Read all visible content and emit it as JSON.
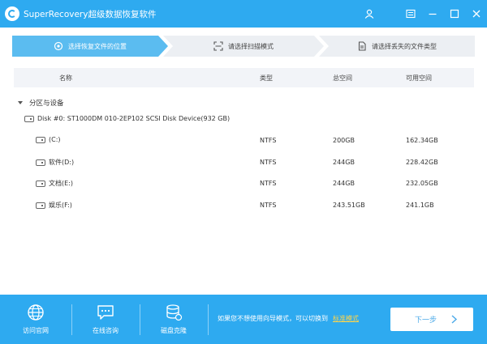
{
  "app": {
    "title": "SuperRecovery超级数据恢复软件"
  },
  "colors": {
    "brand": "#2eaaf0",
    "step_active": "#5bbcf0",
    "step_inactive": "#eceff3",
    "link": "#ffd54a"
  },
  "steps": [
    {
      "label": "选择恢复文件的位置",
      "icon": "location-target-icon",
      "active": true
    },
    {
      "label": "请选择扫描模式",
      "icon": "scan-frame-icon",
      "active": false
    },
    {
      "label": "请选择丢失的文件类型",
      "icon": "document-icon",
      "active": false
    }
  ],
  "table": {
    "headers": {
      "name": "名称",
      "type": "类型",
      "total": "总空间",
      "free": "可用空间"
    },
    "group": {
      "label": "分区与设备"
    },
    "disk": {
      "label": "Disk #0: ST1000DM 010-2EP102 SCSI Disk Device(932 GB)"
    },
    "partitions": [
      {
        "name": "(C:)",
        "type": "NTFS",
        "total": "200GB",
        "free": "162.34GB"
      },
      {
        "name": "软件(D:)",
        "type": "NTFS",
        "total": "244GB",
        "free": "228.42GB"
      },
      {
        "name": "文档(E:)",
        "type": "NTFS",
        "total": "244GB",
        "free": "232.05GB"
      },
      {
        "name": "娱乐(F:)",
        "type": "NTFS",
        "total": "243.51GB",
        "free": "241.1GB"
      }
    ]
  },
  "footer": {
    "website": "访问官网",
    "consult": "在线咨询",
    "clone": "磁盘克隆",
    "hint": "如果您不想使用向导模式，可以切换到",
    "hint_link": "标准模式",
    "next": "下一步"
  }
}
